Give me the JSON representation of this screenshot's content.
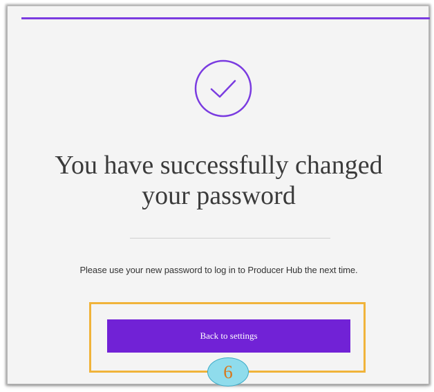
{
  "icons": {
    "success": "check-circle-icon"
  },
  "colors": {
    "accent": "#7a3be0",
    "button": "#7122d6",
    "highlight": "#f0b33a",
    "badge": "#8fdcec"
  },
  "dialog": {
    "title_line1": "You have successfully changed",
    "title_line2": "your password",
    "message": "Please use your new password to log in to Producer Hub the next time.",
    "button_label": "Back to settings"
  },
  "annotation": {
    "step_number": "6"
  }
}
